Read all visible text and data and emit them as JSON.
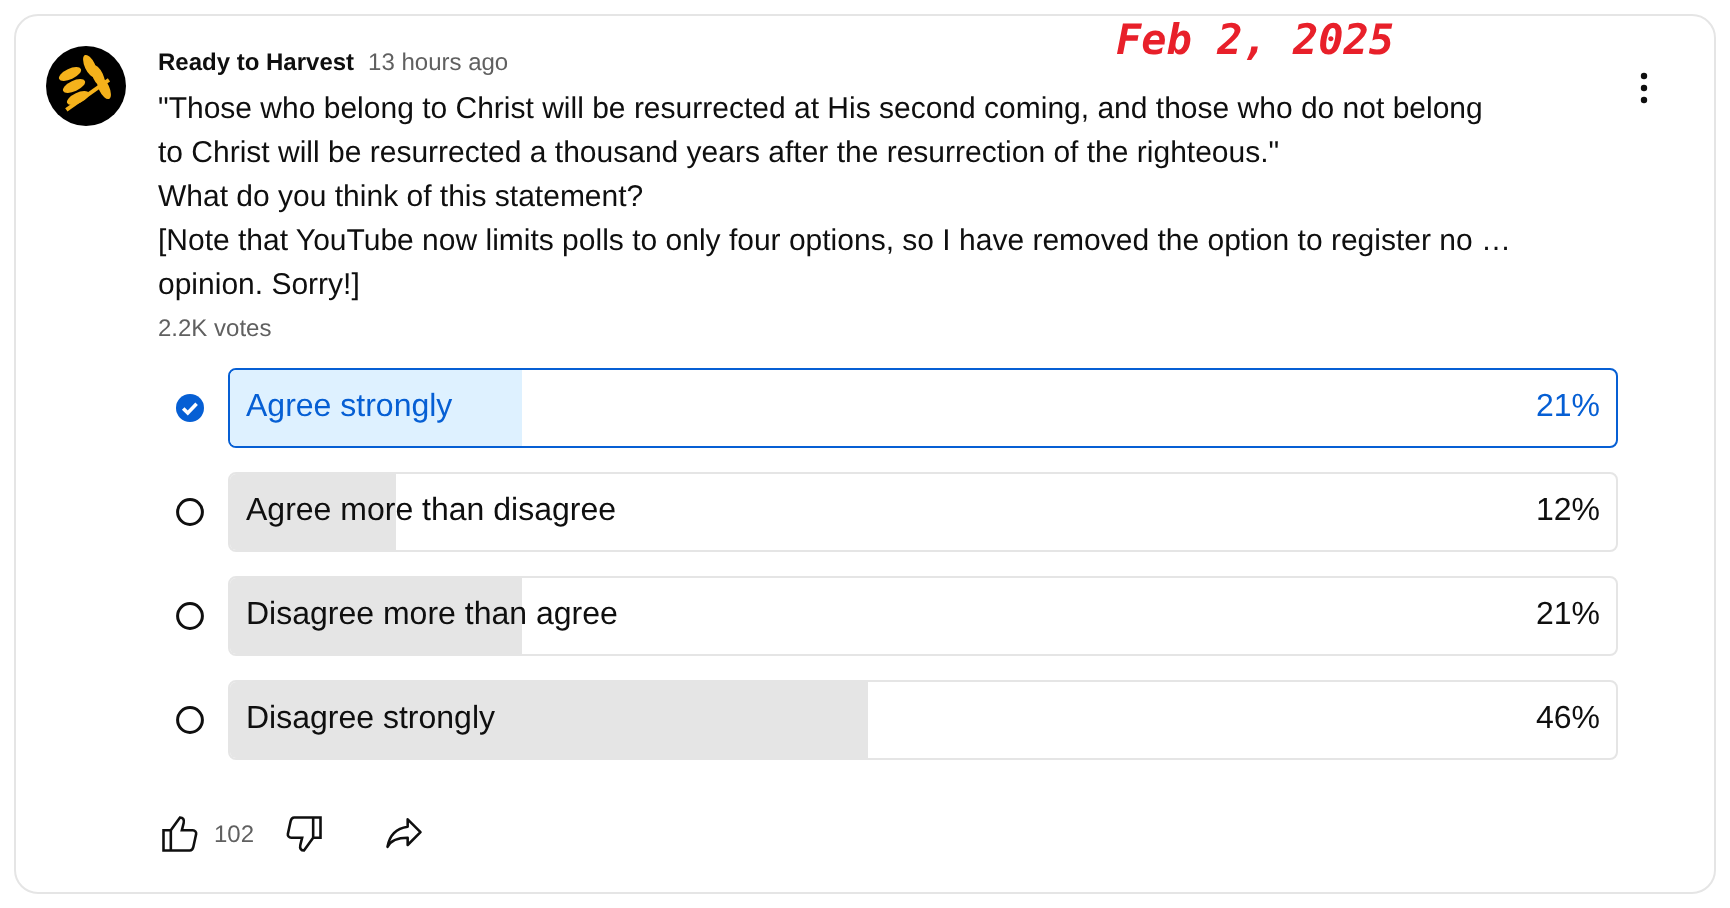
{
  "annotation": "Feb 2, 2025",
  "post": {
    "author": "Ready to Harvest",
    "time": "13 hours ago",
    "lines": [
      "\"Those who belong to Christ will be resurrected at His second coming, and those who do not belong",
      "to Christ will be resurrected a thousand years after the resurrection of the righteous.\"",
      "What do you think of this statement?",
      "[Note that YouTube now limits polls to only four options, so I have removed the option to register no …",
      "opinion. Sorry!]"
    ],
    "votes": "2.2K votes"
  },
  "options": [
    {
      "label": "Agree strongly",
      "percent": "21%",
      "level": 0.21,
      "selected": true
    },
    {
      "label": "Agree more than disagree",
      "percent": "12%",
      "level": 0.12,
      "selected": false
    },
    {
      "label": "Disagree more than agree",
      "percent": "21%",
      "level": 0.21,
      "selected": false
    },
    {
      "label": "Disagree strongly",
      "percent": "46%",
      "level": 0.46,
      "selected": false
    }
  ],
  "likes": "102"
}
